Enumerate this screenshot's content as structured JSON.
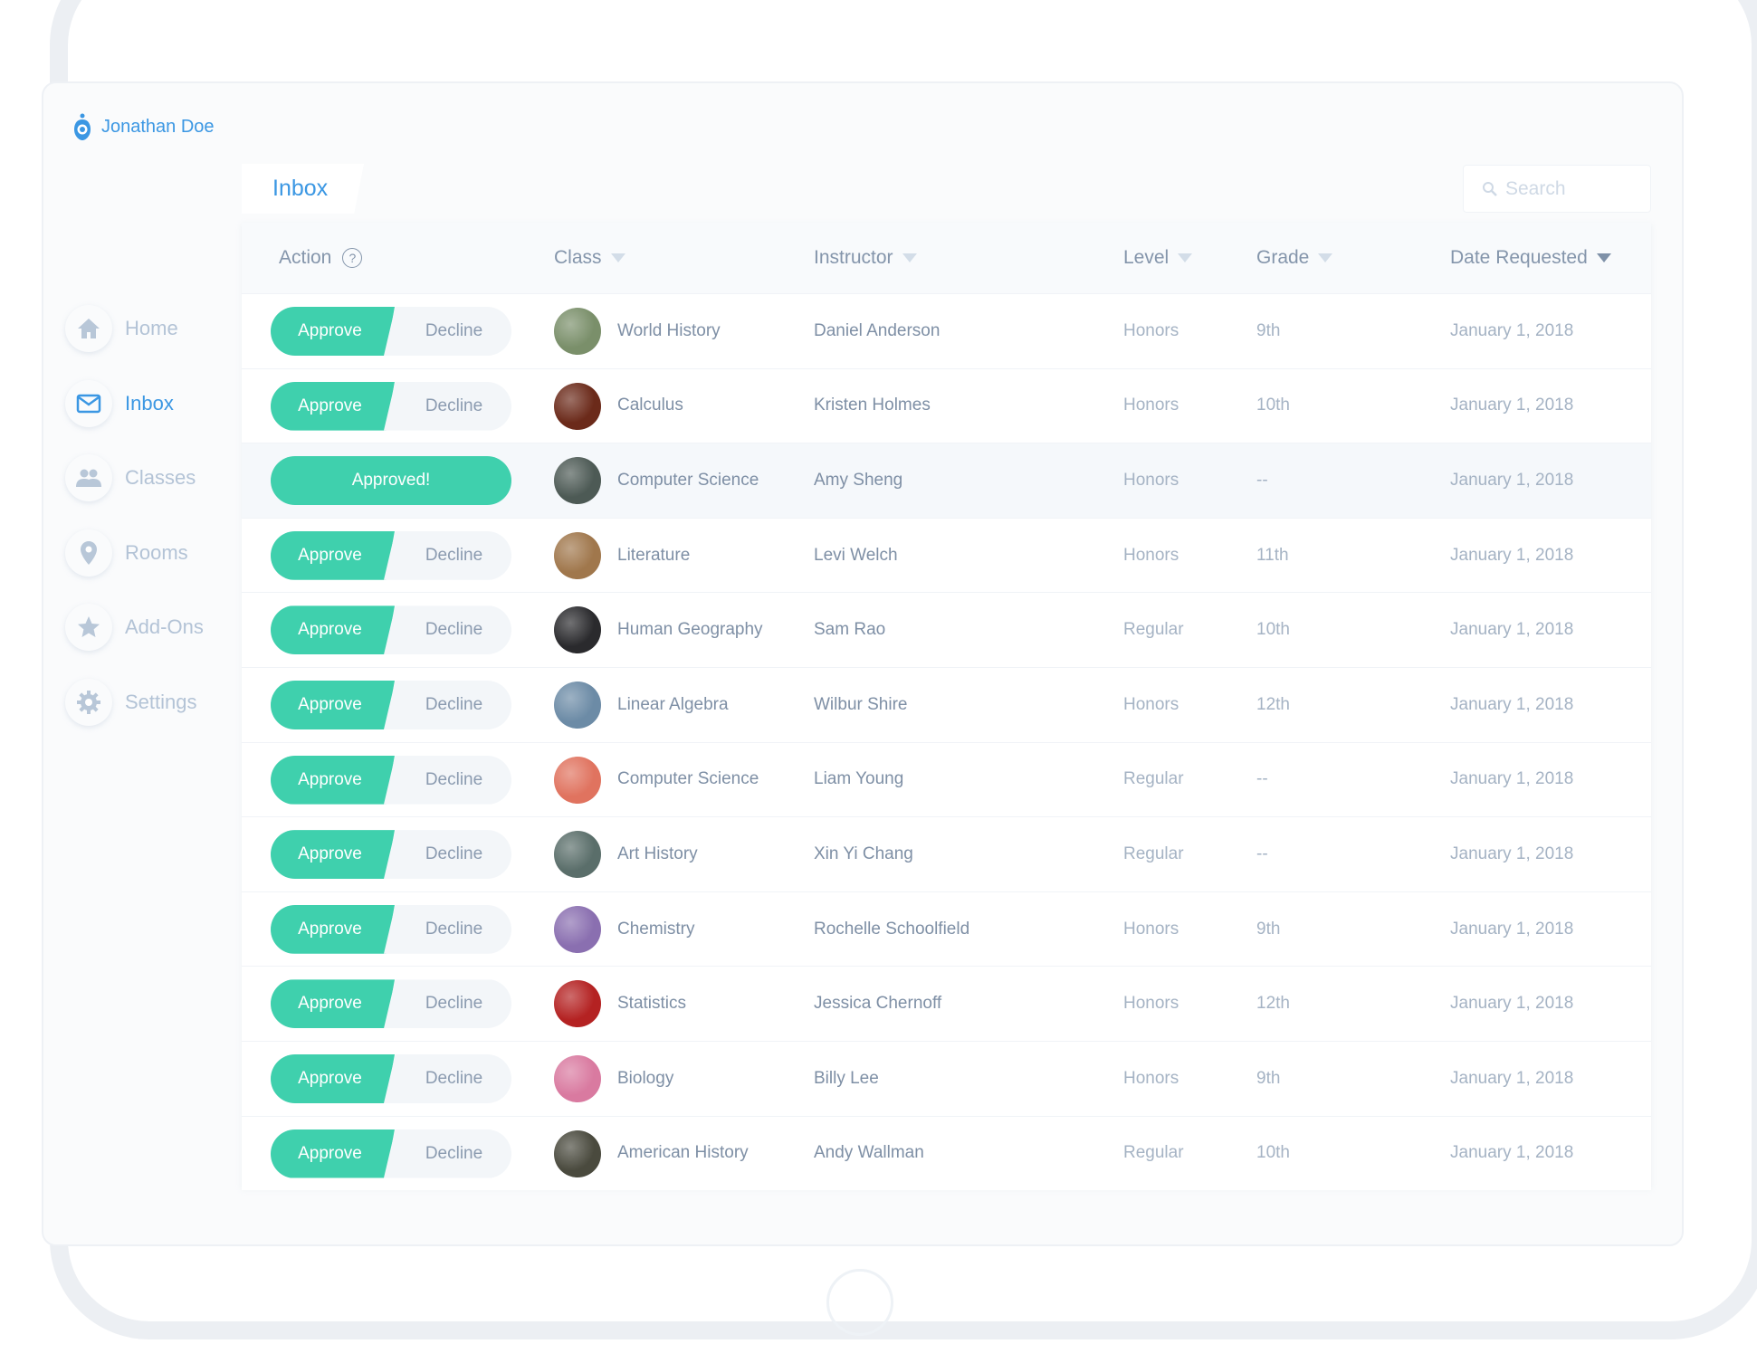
{
  "user": {
    "name": "Jonathan Doe"
  },
  "sidebar": {
    "items": [
      {
        "label": "Home",
        "icon": "home-icon",
        "active": false
      },
      {
        "label": "Inbox",
        "icon": "envelope-icon",
        "active": true
      },
      {
        "label": "Classes",
        "icon": "users-icon",
        "active": false
      },
      {
        "label": "Rooms",
        "icon": "map-pin-icon",
        "active": false
      },
      {
        "label": "Add-Ons",
        "icon": "star-icon",
        "active": false
      },
      {
        "label": "Settings",
        "icon": "gear-icon",
        "active": false
      }
    ]
  },
  "tab": {
    "label": "Inbox"
  },
  "search": {
    "placeholder": "Search"
  },
  "table": {
    "columns": {
      "action": "Action",
      "class": "Class",
      "instructor": "Instructor",
      "level": "Level",
      "grade": "Grade",
      "date": "Date Requested"
    },
    "buttons": {
      "approve": "Approve",
      "decline": "Decline",
      "approved": "Approved!"
    },
    "rows": [
      {
        "status": "pending",
        "class": "World History",
        "instructor": "Daniel Anderson",
        "level": "Honors",
        "grade": "9th",
        "date": "January 1, 2018",
        "avatar_color": "#7a8f6a"
      },
      {
        "status": "pending",
        "class": "Calculus",
        "instructor": "Kristen Holmes",
        "level": "Honors",
        "grade": "10th",
        "date": "January 1, 2018",
        "avatar_color": "#6b2a1a"
      },
      {
        "status": "approved",
        "class": "Computer Science",
        "instructor": "Amy Sheng",
        "level": "Honors",
        "grade": "--",
        "date": "January 1, 2018",
        "avatar_color": "#4d5a55"
      },
      {
        "status": "pending",
        "class": "Literature",
        "instructor": "Levi Welch",
        "level": "Honors",
        "grade": "11th",
        "date": "January 1, 2018",
        "avatar_color": "#a0774c"
      },
      {
        "status": "pending",
        "class": "Human Geography",
        "instructor": "Sam Rao",
        "level": "Regular",
        "grade": "10th",
        "date": "January 1, 2018",
        "avatar_color": "#2a2a2d"
      },
      {
        "status": "pending",
        "class": "Linear Algebra",
        "instructor": "Wilbur Shire",
        "level": "Honors",
        "grade": "12th",
        "date": "January 1, 2018",
        "avatar_color": "#6c8ba6"
      },
      {
        "status": "pending",
        "class": "Computer Science",
        "instructor": "Liam Young",
        "level": "Regular",
        "grade": "--",
        "date": "January 1, 2018",
        "avatar_color": "#e0735f"
      },
      {
        "status": "pending",
        "class": "Art History",
        "instructor": "Xin Yi Chang",
        "level": "Regular",
        "grade": "--",
        "date": "January 1, 2018",
        "avatar_color": "#5a6e6a"
      },
      {
        "status": "pending",
        "class": "Chemistry",
        "instructor": "Rochelle Schoolfield",
        "level": "Honors",
        "grade": "9th",
        "date": "January 1, 2018",
        "avatar_color": "#8a6fb0"
      },
      {
        "status": "pending",
        "class": "Statistics",
        "instructor": "Jessica Chernoff",
        "level": "Honors",
        "grade": "12th",
        "date": "January 1, 2018",
        "avatar_color": "#b42222"
      },
      {
        "status": "pending",
        "class": "Biology",
        "instructor": "Billy Lee",
        "level": "Honors",
        "grade": "9th",
        "date": "January 1, 2018",
        "avatar_color": "#d97aa0"
      },
      {
        "status": "pending",
        "class": "American History",
        "instructor": "Andy Wallman",
        "level": "Regular",
        "grade": "10th",
        "date": "January 1, 2018",
        "avatar_color": "#4a4a3e"
      }
    ]
  },
  "colors": {
    "accent": "#3b97e3",
    "approve": "#3fd0ad",
    "muted": "#b3c3d6"
  }
}
